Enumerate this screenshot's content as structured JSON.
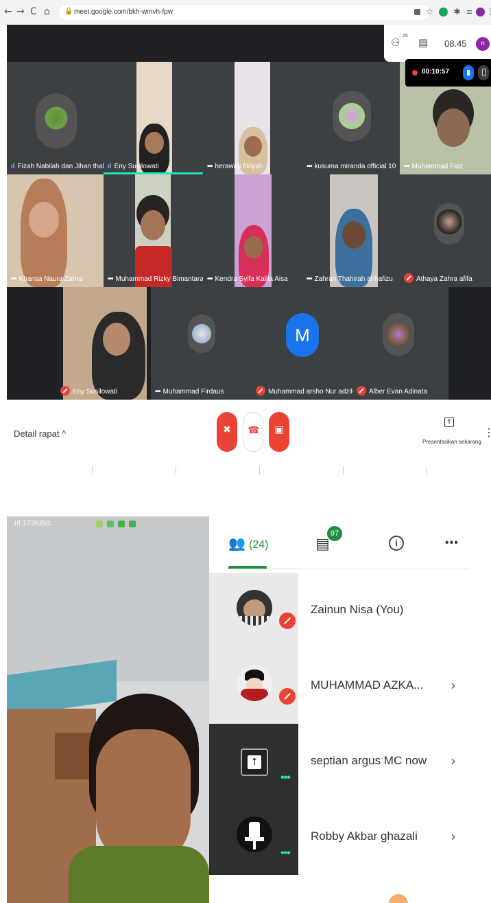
{
  "browser": {
    "url": "meet.google.com/bkh-wmvh-fpw",
    "nav": {
      "back": "←",
      "forward": "→",
      "reload": "C",
      "home": "⌂"
    },
    "lock": "🔒"
  },
  "meet": {
    "top_panel": {
      "people_count": "15",
      "time": "08.45",
      "avatar_letter": "n"
    },
    "recording": {
      "timer": "00:10:57"
    },
    "tiles": [
      {
        "name": "Fizah Nabilah dan Jihan thalita ulfa",
        "indicator": "audio"
      },
      {
        "name": "Eny Susilowati",
        "indicator": "audio",
        "speaking": true
      },
      {
        "name": "herawati fitriyah",
        "indicator": "dots"
      },
      {
        "name": "kusuma miranda official 10",
        "indicator": "dots"
      },
      {
        "name": "Muhammad Faiz",
        "indicator": "dots"
      },
      {
        "name": "Khansa Naura Zahra",
        "indicator": "dots"
      },
      {
        "name": "Muhammad Rizky Bimantara",
        "indicator": "dots"
      },
      {
        "name": "Kendra Syifa Kalila Aisa",
        "indicator": "dots"
      },
      {
        "name": "Zahrah Thahirah al-hafizu",
        "indicator": "dots"
      },
      {
        "name": "Athaya Zahra afifa",
        "indicator": "muted"
      },
      {
        "name": "Eny Susilowati",
        "indicator": "muted"
      },
      {
        "name": "Muhammad Firdaus",
        "indicator": "dots"
      },
      {
        "name": "Muhammad arsho Nur adzikra",
        "indicator": "muted",
        "avatar_letter": "M"
      },
      {
        "name": "Alber Evan Adinata",
        "indicator": "muted"
      }
    ],
    "controls": {
      "detail": "Detail rapat ^",
      "present": "Presentasikan sekarang"
    }
  },
  "phone": {
    "status": ".ııl 173KB/s",
    "tabs": {
      "people_count": "(24)",
      "chat_badge": "97",
      "info": "i",
      "more": "•••"
    },
    "participants": [
      {
        "name": "Zainun Nisa (You)",
        "muted": true,
        "chevron": false
      },
      {
        "name": "MUHAMMAD AZKA...",
        "muted": true,
        "chevron": true
      },
      {
        "name": "septian argus MC now",
        "muted": false,
        "chevron": true,
        "speaking": true
      },
      {
        "name": "Robby Akbar ghazali",
        "muted": false,
        "chevron": true,
        "speaking": true
      }
    ]
  },
  "colors": {
    "accent_green": "#1e8e3e",
    "mute_red": "#ea4335",
    "speaking_teal": "#1de9b6",
    "meet_bg": "#202124"
  }
}
